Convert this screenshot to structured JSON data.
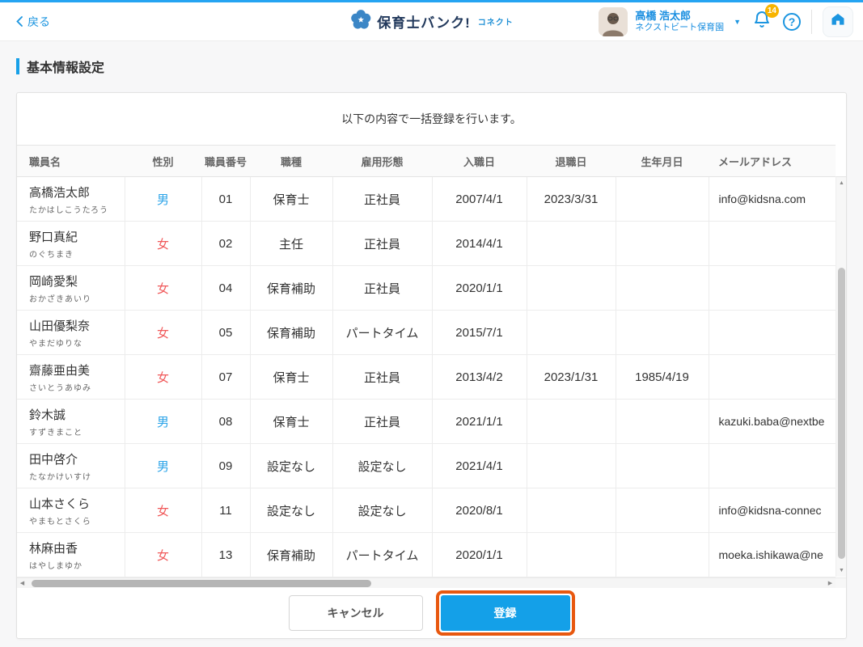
{
  "header": {
    "back_label": "戻る",
    "logo_title": "保育士バンク!",
    "logo_sub": "コネクト",
    "user_name": "高橋 浩太郎",
    "user_org": "ネクストビート保育園",
    "notification_count": "14",
    "help_label": "?"
  },
  "page": {
    "title": "基本情報設定"
  },
  "card": {
    "message": "以下の内容で一括登録を行います。"
  },
  "table": {
    "columns": [
      "職員名",
      "性別",
      "職員番号",
      "職種",
      "雇用形態",
      "入職日",
      "退職日",
      "生年月日",
      "メールアドレス"
    ],
    "rows": [
      {
        "name": "高橋浩太郎",
        "furigana": "たかはしこうたろう",
        "gender": "男",
        "gender_color": "male",
        "number": "01",
        "job": "保育士",
        "employment": "正社員",
        "hire_date": "2007/4/1",
        "retire_date": "2023/3/31",
        "birth_date": "",
        "email": "info@kidsna.com"
      },
      {
        "name": "野口真紀",
        "furigana": "のぐちまき",
        "gender": "女",
        "gender_color": "female",
        "number": "02",
        "job": "主任",
        "employment": "正社員",
        "hire_date": "2014/4/1",
        "retire_date": "",
        "birth_date": "",
        "email": ""
      },
      {
        "name": "岡崎愛梨",
        "furigana": "おかざきあいり",
        "gender": "女",
        "gender_color": "female",
        "number": "04",
        "job": "保育補助",
        "employment": "正社員",
        "hire_date": "2020/1/1",
        "retire_date": "",
        "birth_date": "",
        "email": ""
      },
      {
        "name": "山田優梨奈",
        "furigana": "やまだゆりな",
        "gender": "女",
        "gender_color": "female",
        "number": "05",
        "job": "保育補助",
        "employment": "パートタイム",
        "hire_date": "2015/7/1",
        "retire_date": "",
        "birth_date": "",
        "email": ""
      },
      {
        "name": "齋藤亜由美",
        "furigana": "さいとうあゆみ",
        "gender": "女",
        "gender_color": "female",
        "number": "07",
        "job": "保育士",
        "employment": "正社員",
        "hire_date": "2013/4/2",
        "retire_date": "2023/1/31",
        "birth_date": "1985/4/19",
        "email": ""
      },
      {
        "name": "鈴木誠",
        "furigana": "すずきまこと",
        "gender": "男",
        "gender_color": "male",
        "number": "08",
        "job": "保育士",
        "employment": "正社員",
        "hire_date": "2021/1/1",
        "retire_date": "",
        "birth_date": "",
        "email": "kazuki.baba@nextbe"
      },
      {
        "name": "田中啓介",
        "furigana": "たなかけいすけ",
        "gender": "男",
        "gender_color": "male",
        "number": "09",
        "job": "設定なし",
        "employment": "設定なし",
        "hire_date": "2021/4/1",
        "retire_date": "",
        "birth_date": "",
        "email": ""
      },
      {
        "name": "山本さくら",
        "furigana": "やまもとさくら",
        "gender": "女",
        "gender_color": "female",
        "number": "11",
        "job": "設定なし",
        "employment": "設定なし",
        "hire_date": "2020/8/1",
        "retire_date": "",
        "birth_date": "",
        "email": "info@kidsna-connec"
      },
      {
        "name": "林麻由香",
        "furigana": "はやしまゆか",
        "gender": "女",
        "gender_color": "female",
        "number": "13",
        "job": "保育補助",
        "employment": "パートタイム",
        "hire_date": "2020/1/1",
        "retire_date": "",
        "birth_date": "",
        "email": "moeka.ishikawa@ne"
      }
    ]
  },
  "actions": {
    "cancel_label": "キャンセル",
    "submit_label": "登録"
  },
  "colors": {
    "accent_blue": "#14a0e8",
    "link_blue": "#1b95e0",
    "male_blue": "#2aa3e8",
    "female_red": "#f0595a",
    "highlight_orange": "#e8580f",
    "badge_yellow": "#f8b400",
    "logo_navy": "#22395c"
  }
}
